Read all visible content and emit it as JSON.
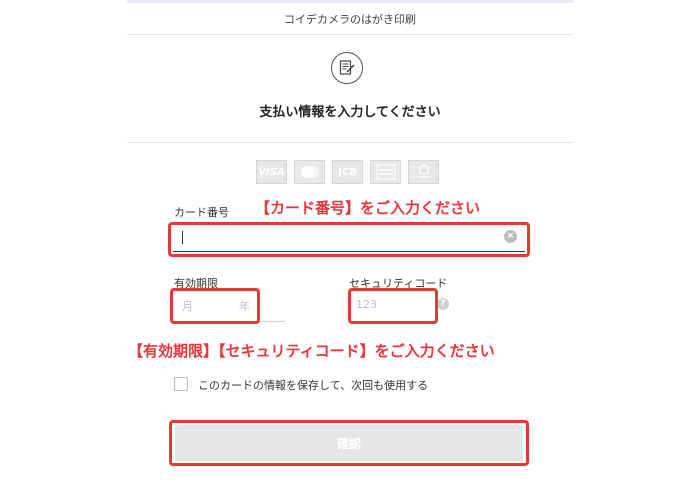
{
  "header": {
    "store_name": "コイデカメラのはがき印刷",
    "title": "支払い情報を入力してください",
    "icon": "payment-document-icon"
  },
  "card_brands": [
    "VISA",
    "Mastercard",
    "JCB",
    "American Express",
    "Diners Club"
  ],
  "form": {
    "card_number_label": "カード番号",
    "card_number_value": "",
    "clear_icon": "×",
    "expiry_label": "有効期限",
    "expiry_month_placeholder": "月",
    "expiry_year_placeholder": "年",
    "security_code_label": "セキュリティコード",
    "security_code_placeholder": "123",
    "help_icon": "?",
    "save_card_label": "このカードの情報を保存して、次回も使用する",
    "save_card_checked": false,
    "confirm_button": "確認"
  },
  "annotations": {
    "card_number": "【カード番号】をご入力ください",
    "expiry_security": "【有効期限】【セキュリティコード】をご入力ください"
  },
  "colors": {
    "annotation_red": "#e8363a",
    "button_disabled": "#e6e6e6"
  }
}
